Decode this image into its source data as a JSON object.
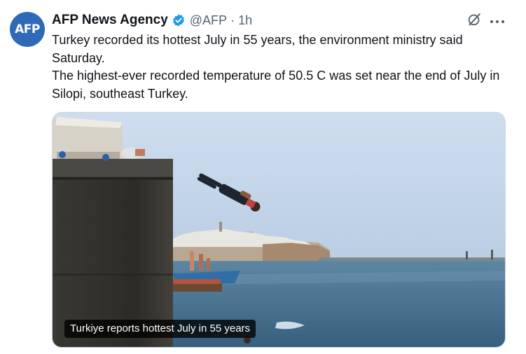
{
  "author": {
    "avatar_text": "AFP",
    "name": "AFP News Agency",
    "handle": "@AFP",
    "separator": "·",
    "time": "1h"
  },
  "tweet": {
    "paragraphs": [
      "Turkey recorded its hottest July in 55 years, the environment ministry said Saturday.",
      "The highest-ever recorded temperature of 50.5 C was set near the end of July in Silopi, southeast Turkey."
    ]
  },
  "media": {
    "caption": "Turkiye reports hottest July in 55 years"
  },
  "icons": {
    "verified": "verified-badge-icon",
    "grok": "grok-icon",
    "more": "more-options-icon"
  },
  "colors": {
    "avatar_bg": "#2f6ab8",
    "verified": "#1d9bf0",
    "secondary_text": "#536471"
  }
}
